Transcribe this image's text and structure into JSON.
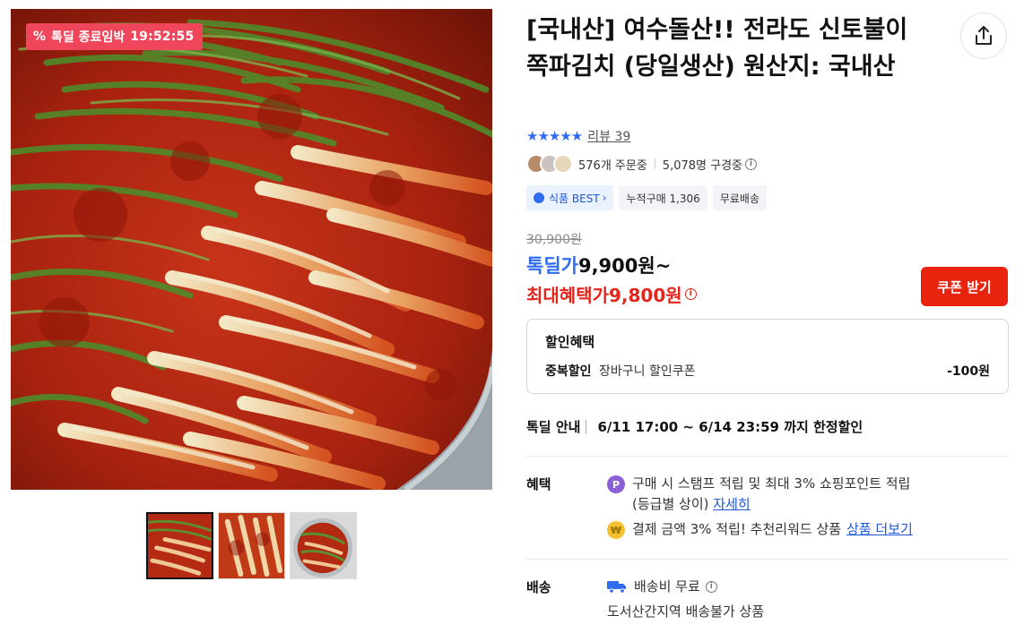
{
  "product": {
    "title": "[국내산] 여수돌산!! 전라도 신토불이 쪽파김치 (당일생산) 원산지: 국내산"
  },
  "deal_timer": {
    "icon": "percent-icon",
    "label": "톡딜 종료임박",
    "time": "19:52:55"
  },
  "rating": {
    "stars": "★★★★★",
    "review_label": "리뷰 39"
  },
  "stats": {
    "orders": "576개 주문중",
    "viewers": "5,078명 구경중"
  },
  "badges": {
    "best": "식품 BEST",
    "cumulative": "누적구매 1,306",
    "free_shipping": "무료배송"
  },
  "price": {
    "original": "30,900원",
    "deal_label": "톡딜가",
    "deal_value": "9,900원~",
    "max_label": "최대혜택가",
    "max_value": "9,800원"
  },
  "coupon_button": "쿠폰 받기",
  "discount": {
    "title": "할인혜택",
    "name": "중복할인",
    "desc": "장바구니 할인쿠폰",
    "amount": "-100원"
  },
  "deal_info": {
    "label": "톡딜 안내",
    "value": "6/11 17:00 ~ 6/14 23:59 까지 한정할인"
  },
  "benefits": {
    "label": "혜택",
    "line1": "구매 시 스탬프 적립 및 최대 3% 쇼핑포인트 적립",
    "line1b": "(등급별 상이)",
    "line1_link": "자세히",
    "line2": "결제 금액 3% 적립! 추천리워드 상품",
    "line2_link": "상품 더보기"
  },
  "shipping": {
    "label": "배송",
    "fee": "배송비 무료",
    "note": "도서산간지역 배송불가 상품"
  },
  "colors": {
    "accent_blue": "#2f6bf0",
    "price_red": "#e5241c",
    "coupon_red": "#e8240f",
    "timer_pink": "#f0465b"
  }
}
